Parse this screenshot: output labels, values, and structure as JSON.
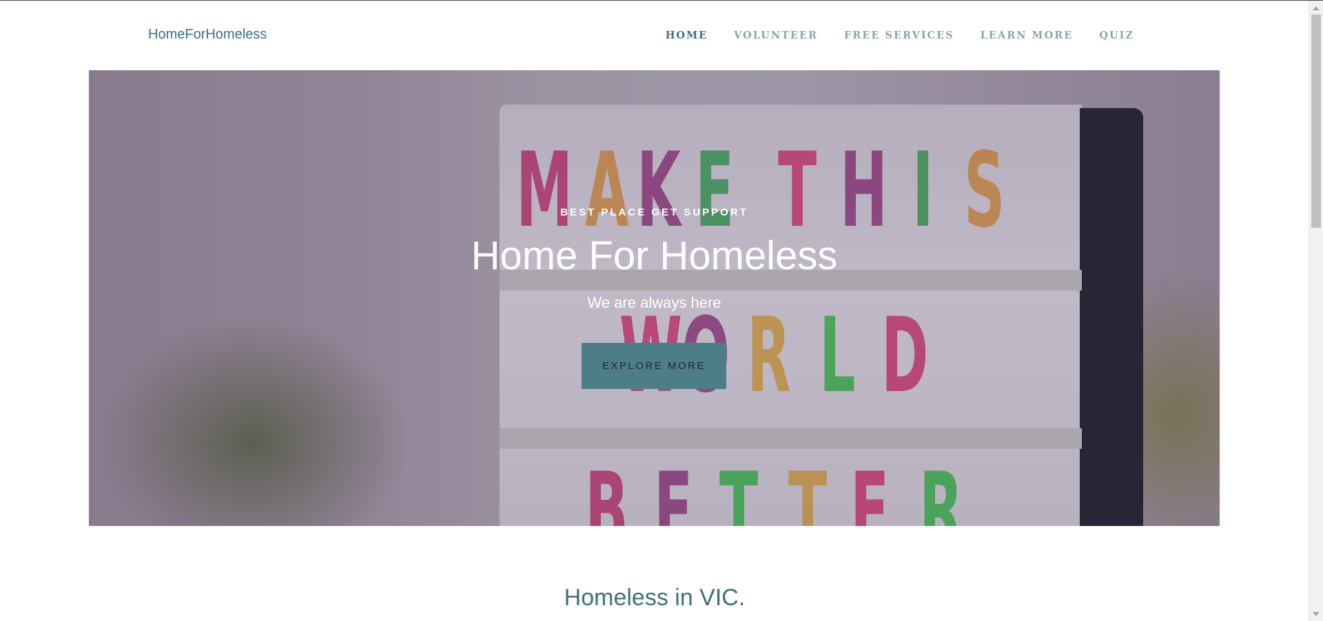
{
  "header": {
    "brand": "HomeForHomeless",
    "nav": [
      {
        "label": "HOME",
        "active": true
      },
      {
        "label": "VOLUNTEER",
        "active": false
      },
      {
        "label": "FREE SERVICES",
        "active": false
      },
      {
        "label": "LEARN MORE",
        "active": false
      },
      {
        "label": "QUIZ",
        "active": false
      }
    ]
  },
  "hero": {
    "eyebrow": "BEST PLACE GET SUPPORT",
    "title": "Home For Homeless",
    "subtitle": "We are always here",
    "cta_label": "EXPLORE MORE",
    "sign_row1": [
      "M",
      "A",
      "K",
      "E",
      "T",
      "H",
      "I",
      "S"
    ],
    "sign_row2": [
      "W",
      "O",
      "R",
      "L",
      "D"
    ],
    "sign_row3": [
      "B",
      "E",
      "T",
      "T",
      "E",
      "R"
    ]
  },
  "section": {
    "title": "Homeless in VIC."
  },
  "colors": {
    "accent": "#3f6f7a",
    "nav_inactive": "#8aa5ad",
    "cta_bg": "#4d7d86"
  }
}
